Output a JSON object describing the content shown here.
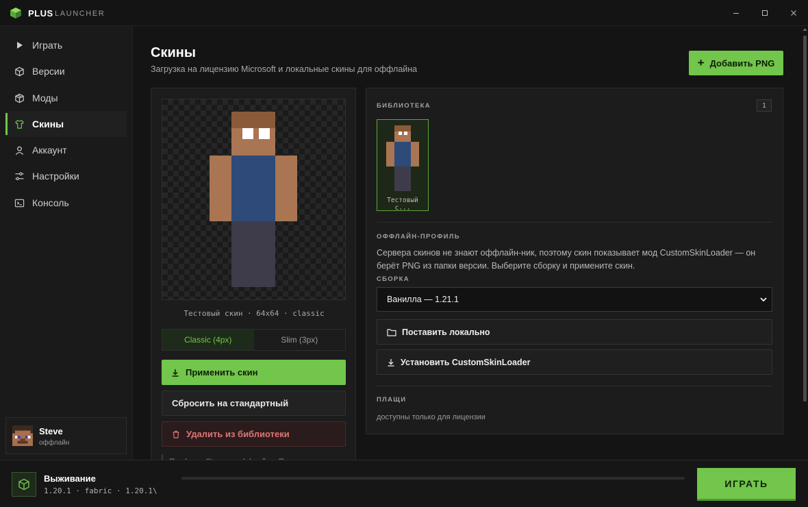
{
  "app": {
    "brand": "PLUS",
    "brand_sub": "LAUNCHER",
    "accent": "#72c64b"
  },
  "window_controls": [
    "minimize-icon",
    "maximize-icon",
    "close-icon"
  ],
  "sidebar": {
    "items": [
      {
        "label": "Играть",
        "icon": "play-icon",
        "active": false
      },
      {
        "label": "Версии",
        "icon": "cube-icon",
        "active": false
      },
      {
        "label": "Моды",
        "icon": "box-icon",
        "active": false
      },
      {
        "label": "Скины",
        "icon": "shirt-icon",
        "active": true
      },
      {
        "label": "Аккаунт",
        "icon": "user-icon",
        "active": false
      },
      {
        "label": "Настройки",
        "icon": "sliders-icon",
        "active": false
      },
      {
        "label": "Консоль",
        "icon": "terminal-icon",
        "active": false
      }
    ],
    "profile": {
      "name": "Steve",
      "status": "оффлайн"
    }
  },
  "page": {
    "title": "Скины",
    "subtitle": "Загрузка на лицензию Microsoft и локальные скины для оффлайна",
    "add_button": "Добавить PNG"
  },
  "editor": {
    "caption": "Тестовый скин · 64x64 · classic",
    "model_options": [
      {
        "label": "Classic (4px)",
        "selected": true
      },
      {
        "label": "Slim (3px)",
        "selected": false
      }
    ],
    "apply_button": "Применить скин",
    "reset_button": "Сбросить на стандартный",
    "delete_button": "Удалить из библиотеки",
    "note": "Профиль: Steve — оффлайн. «Применить»"
  },
  "library": {
    "label": "БИБЛИОТЕКА",
    "count": "1",
    "items": [
      {
        "name": "Тестовый с..."
      }
    ]
  },
  "offline": {
    "label": "ОФФЛАЙН-ПРОФИЛЬ",
    "description": "Сервера скинов не знают оффлайн-ник, поэтому скин показывает мод CustomSkinLoader — он берёт PNG из папки версии. Выберите сборку и примените скин.",
    "build_label": "СБОРКА",
    "build_value": "Ванилла — 1.21.1",
    "local_button": "Поставить локально",
    "install_button": "Установить CustomSkinLoader"
  },
  "capes": {
    "label": "ПЛАЩИ",
    "note": "доступны только для лицензии"
  },
  "bottom": {
    "instance_name": "Выживание",
    "instance_meta": "1.20.1 · fabric · 1.20.1\\",
    "progress": 0,
    "play_button": "ИГРАТЬ"
  }
}
